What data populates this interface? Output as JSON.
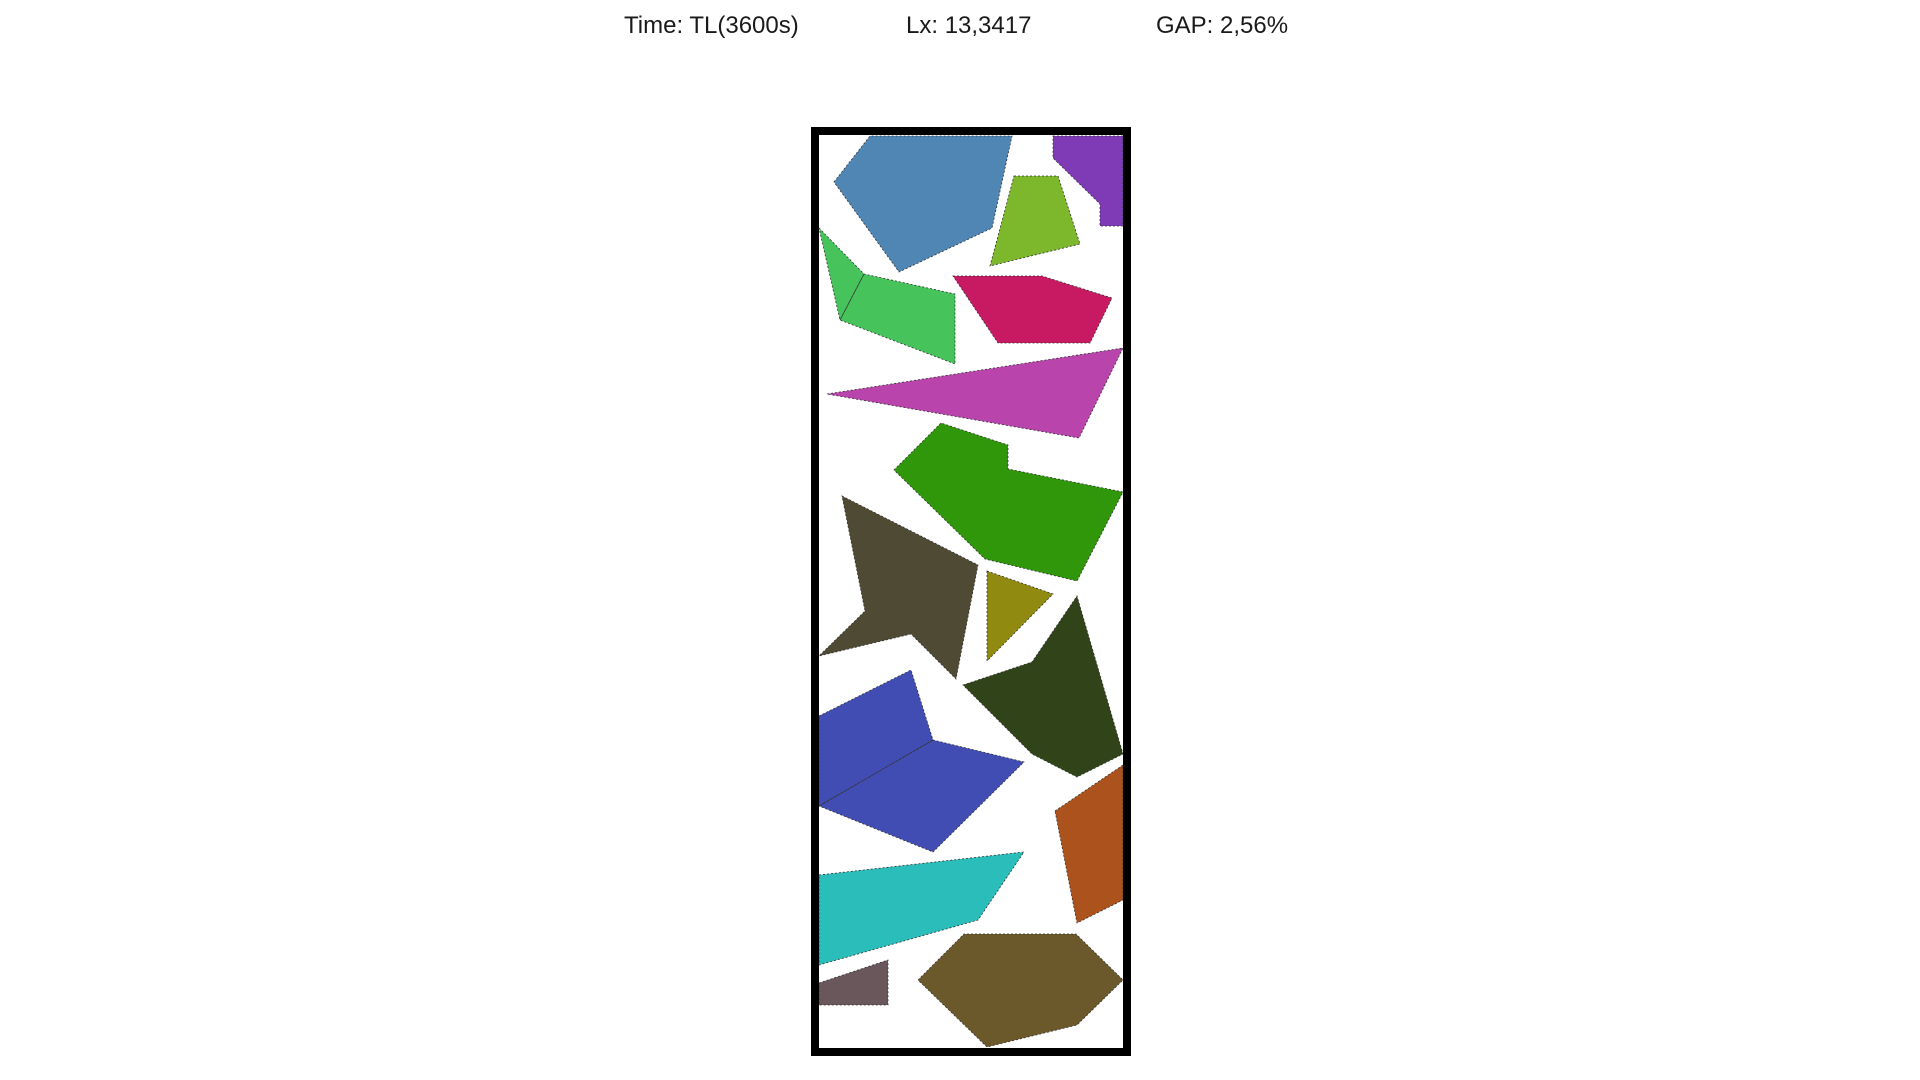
{
  "header": {
    "time_label": "Time:",
    "time_value": "TL(3600s)",
    "lx_label": "Lx:",
    "lx_value": "13,3417",
    "gap_label": "GAP:",
    "gap_value": "2,56%"
  },
  "pieces": [
    {
      "name": "piece-steel-blue-pentagon",
      "color": "#4f86b4"
    },
    {
      "name": "piece-purple-corner",
      "color": "#7f3bb6"
    },
    {
      "name": "piece-lime-trapezoid",
      "color": "#7db72b"
    },
    {
      "name": "piece-green-arrow",
      "color": "#47c35b"
    },
    {
      "name": "piece-crimson-trapezoid",
      "color": "#c81a63"
    },
    {
      "name": "piece-magenta-triangle",
      "color": "#b944ac"
    },
    {
      "name": "piece-forest-green-polygon",
      "color": "#2f9709"
    },
    {
      "name": "piece-dark-olive-arrow",
      "color": "#4f4a33"
    },
    {
      "name": "piece-olive-triangle",
      "color": "#908b10"
    },
    {
      "name": "piece-dark-green-kite",
      "color": "#314319"
    },
    {
      "name": "piece-indigo-chevron",
      "color": "#414db3"
    },
    {
      "name": "piece-rust-quad",
      "color": "#ab521d"
    },
    {
      "name": "piece-teal-wedge",
      "color": "#2abdb9"
    },
    {
      "name": "piece-mauve-rect",
      "color": "#6a575b"
    },
    {
      "name": "piece-brown-hexagon",
      "color": "#6b592c"
    }
  ]
}
